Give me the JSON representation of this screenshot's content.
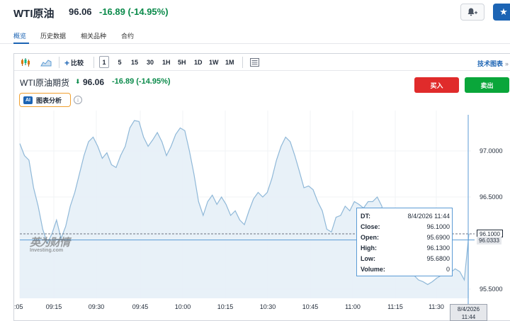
{
  "header": {
    "instrument_name": "WTI原油",
    "price": "96.06",
    "change": "-16.89 (-14.95%)",
    "alert_icon": "bell-plus-icon",
    "watchlist_icon": "star-icon"
  },
  "subnav": {
    "tabs": [
      {
        "label": "概览",
        "active": true
      },
      {
        "label": "历史数据",
        "active": false
      },
      {
        "label": "相关品种",
        "active": false
      },
      {
        "label": "合约",
        "active": false
      }
    ]
  },
  "toolbar": {
    "chart_type_icons": [
      "candlestick-icon",
      "area-chart-icon"
    ],
    "compare_label": "比较",
    "intervals": [
      "1",
      "5",
      "15",
      "30",
      "1H",
      "5H",
      "1D",
      "1W",
      "1M"
    ],
    "active_interval": "1",
    "indicator_icon": "indicator-icon",
    "technical_chart_label": "技术图表",
    "technical_chart_arrow": "»"
  },
  "legend": {
    "title": "WTI原油期货",
    "arrow": "⬇",
    "price": "96.06",
    "change": "-16.89 (-14.95%)"
  },
  "ai_analysis": {
    "badge": "AI",
    "label": "图表分析",
    "info_icon": "info-icon"
  },
  "trade": {
    "buy_label": "买入",
    "sell_label": "卖出"
  },
  "watermark": {
    "cn": "英为财情",
    "en": "Investing.com"
  },
  "tooltip": {
    "rows": [
      {
        "label": "DT:",
        "value": "8/4/2026 11:44"
      },
      {
        "label": "Close:",
        "value": "96.1000"
      },
      {
        "label": "Open:",
        "value": "95.6900"
      },
      {
        "label": "High:",
        "value": "96.1300"
      },
      {
        "label": "Low:",
        "value": "95.6800"
      },
      {
        "label": "Volume:",
        "value": "0"
      }
    ]
  },
  "price_tags": {
    "last": "96.1000",
    "crosshair": "96.0333"
  },
  "crosshair_time": {
    "date": "8/4/2026",
    "time": "11:44"
  },
  "colors": {
    "accent": "#1c64b4",
    "up": "#0a8a4a",
    "buy": "#e02b2b",
    "sell": "#0aa63a",
    "area_line": "#8fb8d8",
    "area_fill": "#e6f0f7"
  },
  "chart_data": {
    "type": "area",
    "x_tick_labels": [
      ":05",
      "09:15",
      "09:30",
      "09:45",
      "10:00",
      "10:15",
      "10:30",
      "10:45",
      "11:00",
      "11:15",
      "11:30"
    ],
    "y_tick_labels": [
      "97.0000",
      "96.5000",
      "95.5000"
    ],
    "ylim": [
      95.4,
      97.4
    ],
    "last_price": 96.1,
    "crosshair_price": 96.0333,
    "grid": true,
    "points": [
      [
        0,
        97.08
      ],
      [
        1,
        96.95
      ],
      [
        2,
        96.9
      ],
      [
        3,
        96.6
      ],
      [
        4,
        96.4
      ],
      [
        5,
        96.15
      ],
      [
        6,
        96.0
      ],
      [
        7,
        96.1
      ],
      [
        8,
        96.25
      ],
      [
        9,
        96.05
      ],
      [
        10,
        96.18
      ],
      [
        11,
        96.4
      ],
      [
        12,
        96.55
      ],
      [
        13,
        96.75
      ],
      [
        14,
        96.95
      ],
      [
        15,
        97.1
      ],
      [
        16,
        97.15
      ],
      [
        17,
        97.05
      ],
      [
        18,
        96.92
      ],
      [
        19,
        96.98
      ],
      [
        20,
        96.85
      ],
      [
        21,
        96.82
      ],
      [
        22,
        96.95
      ],
      [
        23,
        97.05
      ],
      [
        24,
        97.25
      ],
      [
        25,
        97.33
      ],
      [
        26,
        97.32
      ],
      [
        27,
        97.15
      ],
      [
        28,
        97.05
      ],
      [
        29,
        97.12
      ],
      [
        30,
        97.2
      ],
      [
        31,
        97.1
      ],
      [
        32,
        96.95
      ],
      [
        33,
        97.05
      ],
      [
        34,
        97.18
      ],
      [
        35,
        97.25
      ],
      [
        36,
        97.22
      ],
      [
        37,
        97.0
      ],
      [
        38,
        96.75
      ],
      [
        39,
        96.45
      ],
      [
        40,
        96.3
      ],
      [
        41,
        96.45
      ],
      [
        42,
        96.52
      ],
      [
        43,
        96.42
      ],
      [
        44,
        96.5
      ],
      [
        45,
        96.42
      ],
      [
        46,
        96.3
      ],
      [
        47,
        96.35
      ],
      [
        48,
        96.25
      ],
      [
        49,
        96.2
      ],
      [
        50,
        96.35
      ],
      [
        51,
        96.48
      ],
      [
        52,
        96.55
      ],
      [
        53,
        96.5
      ],
      [
        54,
        96.55
      ],
      [
        55,
        96.7
      ],
      [
        56,
        96.9
      ],
      [
        57,
        97.05
      ],
      [
        58,
        97.15
      ],
      [
        59,
        97.1
      ],
      [
        60,
        96.95
      ],
      [
        61,
        96.78
      ],
      [
        62,
        96.6
      ],
      [
        63,
        96.62
      ],
      [
        64,
        96.58
      ],
      [
        65,
        96.45
      ],
      [
        66,
        96.35
      ],
      [
        67,
        96.15
      ],
      [
        68,
        96.12
      ],
      [
        69,
        96.28
      ],
      [
        70,
        96.3
      ],
      [
        71,
        96.4
      ],
      [
        72,
        96.35
      ],
      [
        73,
        96.45
      ],
      [
        74,
        96.42
      ],
      [
        75,
        96.38
      ],
      [
        76,
        96.45
      ],
      [
        77,
        96.45
      ],
      [
        78,
        96.5
      ],
      [
        79,
        96.4
      ],
      [
        80,
        96.05
      ],
      [
        81,
        95.95
      ],
      [
        82,
        95.85
      ],
      [
        83,
        95.8
      ],
      [
        84,
        95.75
      ],
      [
        85,
        95.72
      ],
      [
        86,
        95.65
      ],
      [
        87,
        95.6
      ],
      [
        88,
        95.58
      ],
      [
        89,
        95.55
      ],
      [
        90,
        95.58
      ],
      [
        91,
        95.62
      ],
      [
        92,
        95.65
      ],
      [
        93,
        95.7
      ],
      [
        94,
        95.68
      ],
      [
        95,
        95.72
      ],
      [
        96,
        95.69
      ],
      [
        97,
        95.6
      ],
      [
        98,
        96.1
      ]
    ]
  }
}
